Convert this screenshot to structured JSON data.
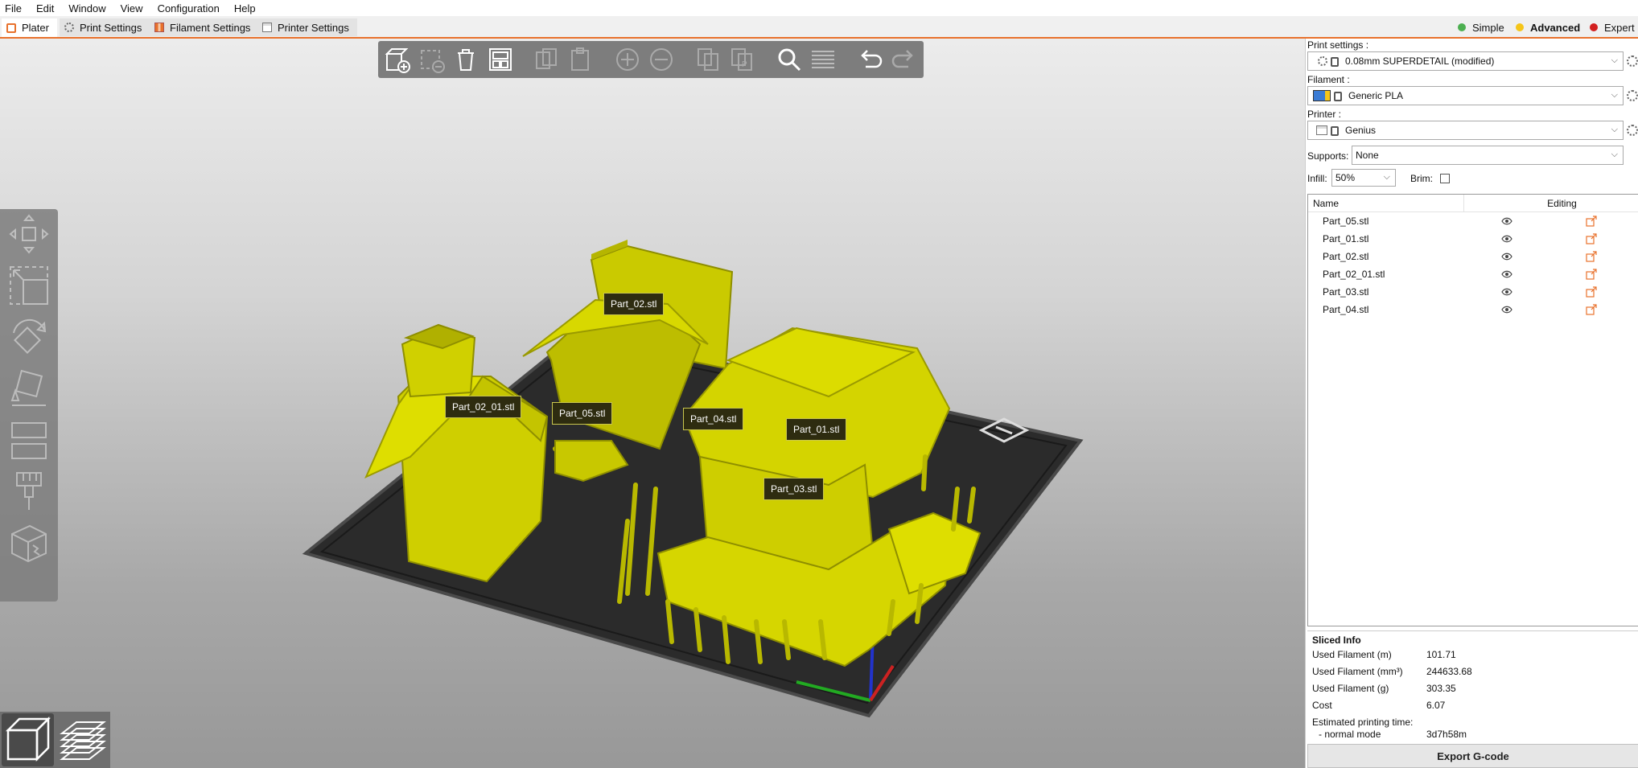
{
  "menu": [
    "File",
    "Edit",
    "Window",
    "View",
    "Configuration",
    "Help"
  ],
  "tabs": {
    "plater": "Plater",
    "print_settings": "Print Settings",
    "filament_settings": "Filament Settings",
    "printer_settings": "Printer Settings"
  },
  "modes": {
    "simple": {
      "label": "Simple",
      "color": "#4caf50"
    },
    "advanced": {
      "label": "Advanced",
      "color": "#f5c518"
    },
    "expert": {
      "label": "Expert",
      "color": "#d21f1f"
    }
  },
  "toolbar": {
    "buttons": [
      "add-icon",
      "delete-icon",
      "delete-all-icon",
      "arrange-icon",
      "copy-icon",
      "paste-icon",
      "add-instance-icon",
      "remove-instance-icon",
      "split-objects-icon",
      "split-parts-icon",
      "search-icon",
      "layers-editing-icon",
      "undo-icon",
      "redo-icon"
    ]
  },
  "left_tools": [
    "move-icon",
    "scale-icon",
    "rotate-icon",
    "place-on-face-icon",
    "cut-icon",
    "paint-supports-icon",
    "seam-painting-icon"
  ],
  "scene": {
    "model_color": "#d8d800",
    "bed_color": "#2b2b2b",
    "part_labels": [
      "Part_02.stl",
      "Part_02_01.stl",
      "Part_05.stl",
      "Part_04.stl",
      "Part_01.stl",
      "Part_03.stl"
    ]
  },
  "panel": {
    "print_settings_label": "Print settings :",
    "print_settings_value": "0.08mm SUPERDETAIL (modified)",
    "filament_label": "Filament :",
    "filament_value": "Generic PLA",
    "printer_label": "Printer :",
    "printer_value": "Genius",
    "supports_label": "Supports:",
    "supports_value": "None",
    "infill_label": "Infill:",
    "infill_value": "50%",
    "brim_label": "Brim:",
    "list_header_name": "Name",
    "list_header_editing": "Editing",
    "objects": [
      "Part_05.stl",
      "Part_01.stl",
      "Part_02.stl",
      "Part_02_01.stl",
      "Part_03.stl",
      "Part_04.stl"
    ]
  },
  "sliced_info": {
    "title": "Sliced Info",
    "rows": [
      {
        "label": "Used Filament (m)",
        "value": "101.71"
      },
      {
        "label": "Used Filament (mm³)",
        "value": "244633.68"
      },
      {
        "label": "Used Filament (g)",
        "value": "303.35"
      },
      {
        "label": "Cost",
        "value": "6.07"
      }
    ],
    "time_label": "Estimated printing time:",
    "mode_label": "- normal mode",
    "mode_value": "3d7h58m"
  },
  "export_label": "Export G-code"
}
